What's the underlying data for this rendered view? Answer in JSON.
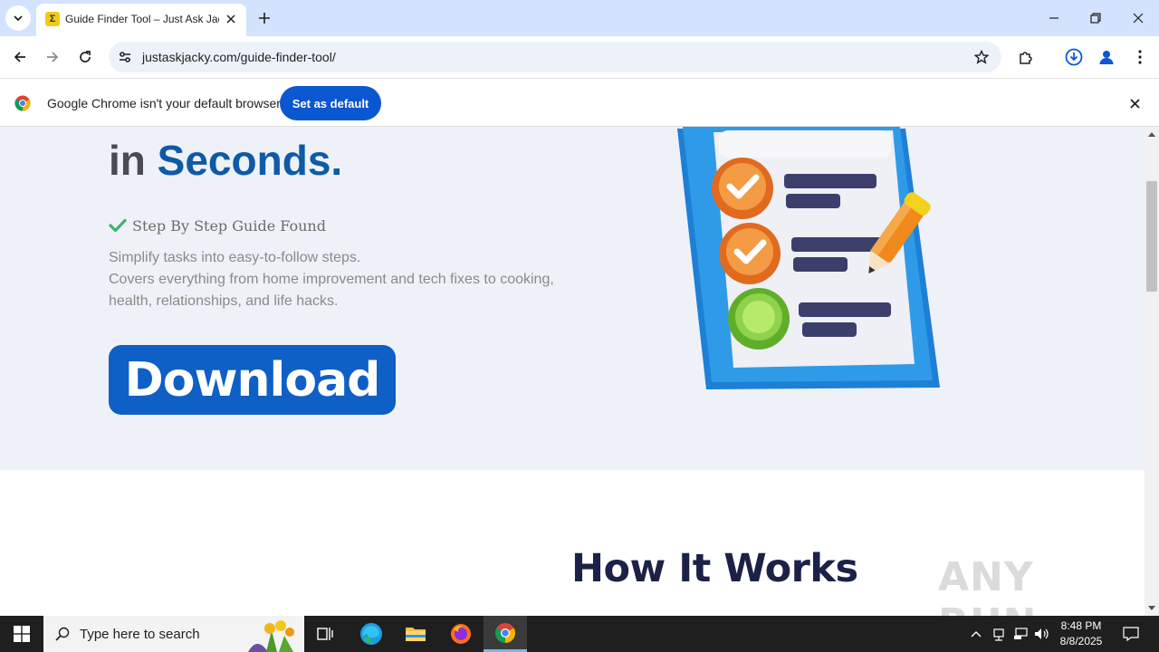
{
  "browser": {
    "tab": {
      "title": "Guide Finder Tool – Just Ask Jacky",
      "favicon_icon": "just-ask-jacky-favicon"
    },
    "url": "justaskjacky.com/guide-finder-tool/"
  },
  "infobar": {
    "message": "Google Chrome isn't your default browser",
    "button": "Set as default"
  },
  "hero": {
    "heading_prefix": "in ",
    "heading_accent": "Seconds.",
    "check_label": "Step By Step Guide Found",
    "desc_line1": "Simplify tasks into easy-to-follow steps.",
    "desc_line2": "Covers everything from home improvement and tech fixes to cooking,",
    "desc_line3": "health, relationships, and life hacks.",
    "download_label": "Download"
  },
  "section": {
    "how_heading": "How It Works"
  },
  "watermark": "ANY RUN",
  "taskbar": {
    "search_placeholder": "Type here to search",
    "time": "8:48 PM",
    "date": "8/8/2025"
  },
  "colors": {
    "accent": "#0e5aa7",
    "download_bg": "#0e5fc6",
    "chrome_blue": "#0b57d0",
    "hero_bg": "#eef1f7"
  }
}
